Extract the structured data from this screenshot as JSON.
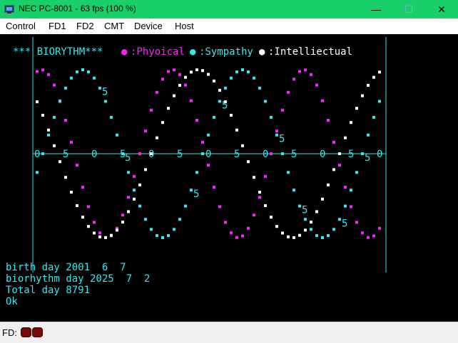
{
  "window": {
    "title": "NEC PC-8001 - 63 fps (100 %)",
    "min_glyph": "—",
    "max_glyph": "☐",
    "close_glyph": "✕"
  },
  "menu": [
    "Control",
    "FD1",
    "FD2",
    "CMT",
    "Device",
    "Host"
  ],
  "screen": {
    "header": "*** BIORYTHM***",
    "legend": [
      {
        "marker": "●",
        "label": ":Phyoical",
        "color": "#ff22ff"
      },
      {
        "marker": "●",
        "label": ":Sympathy",
        "color": "#33e8f0"
      },
      {
        "marker": "●",
        "label": ":Intelliectual",
        "color": "#ffffff"
      }
    ],
    "axis_labels": [
      "0",
      "5",
      "0",
      "5",
      "0",
      "5",
      "0",
      "5",
      "0",
      "5",
      "0",
      "5",
      "0"
    ],
    "day_markers": [
      "5",
      "5",
      "5",
      "5",
      "5",
      "5",
      "5",
      "5"
    ],
    "lines": [
      "birth day 2001  6  7",
      "biorhythm day 2025  7  2",
      "Total day 8791",
      "Ok"
    ]
  },
  "chart_data": {
    "type": "scatter",
    "x_range": [
      0,
      60
    ],
    "y_range": [
      -1,
      1
    ],
    "series": [
      {
        "name": "Phyoical",
        "color": "#ff22ff",
        "period": 23,
        "start_day": 8791
      },
      {
        "name": "Sympathy",
        "color": "#33e8f0",
        "period": 28,
        "start_day": 8791
      },
      {
        "name": "Intelliectual",
        "color": "#ffffff",
        "period": 33,
        "start_day": 8791
      }
    ]
  },
  "status": {
    "fd_label": "FD:"
  }
}
